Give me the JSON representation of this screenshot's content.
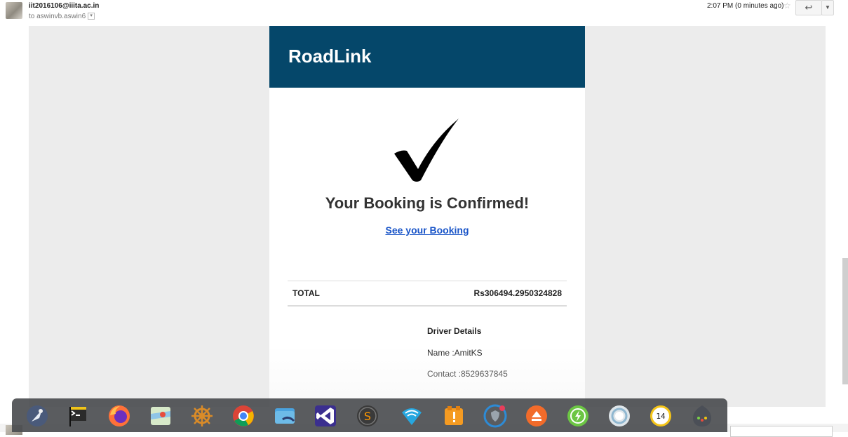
{
  "mail": {
    "sender": "iit2016106@iiita.ac.in",
    "recipient": "to aswinvb.aswin6",
    "time": "2:07 PM (0 minutes ago)",
    "star_icon": "star-icon",
    "reply_icon": "reply-icon",
    "more_icon": "chevron-down-icon"
  },
  "email": {
    "brand": "RoadLink",
    "brand_color": "#05476a",
    "check_icon": "checkmark-icon",
    "headline": "Your Booking is Confirmed!",
    "link_text": "See your Booking",
    "link_color": "#1a55c8",
    "total_label": "TOTAL",
    "total_value": "Rs306494.2950324828",
    "driver": {
      "heading": "Driver Details",
      "name": "Name :AmitKS",
      "contact": "Contact :8529637845"
    }
  },
  "dock": {
    "items": [
      {
        "name": "launcher-icon"
      },
      {
        "name": "terminal-icon"
      },
      {
        "name": "firefox-icon"
      },
      {
        "name": "maps-icon"
      },
      {
        "name": "helm-icon"
      },
      {
        "name": "chrome-icon"
      },
      {
        "name": "files-icon"
      },
      {
        "name": "visual-studio-icon"
      },
      {
        "name": "sublime-icon"
      },
      {
        "name": "wifi-icon"
      },
      {
        "name": "archive-warning-icon"
      },
      {
        "name": "security-icon"
      },
      {
        "name": "eject-icon"
      },
      {
        "name": "power-icon"
      },
      {
        "name": "circle-app-icon"
      },
      {
        "name": "clock-icon"
      },
      {
        "name": "anaconda-icon"
      }
    ]
  }
}
